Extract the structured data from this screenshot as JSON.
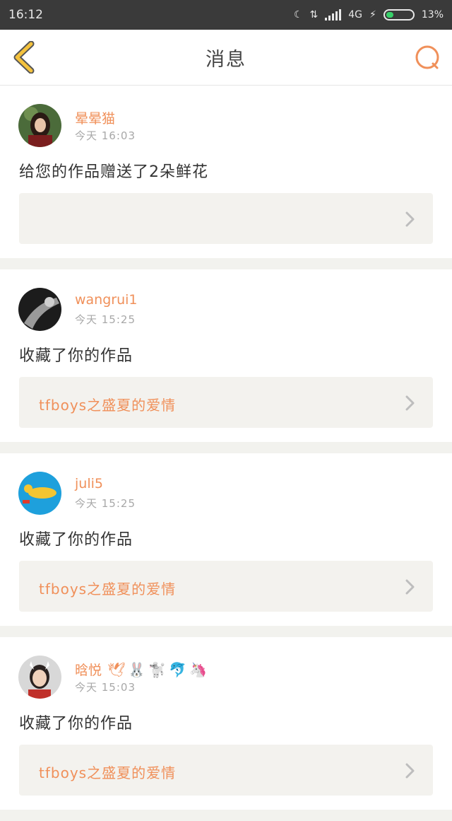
{
  "status_bar": {
    "time": "16:12",
    "network": "4G",
    "battery": "13%"
  },
  "header": {
    "title": "消息",
    "back_icon": "chevron-left-icon",
    "search_icon": "search-icon"
  },
  "colors": {
    "accent": "#f0905a",
    "back_arrow": "#f4c23d",
    "card_bg": "#ffffff",
    "work_bg": "#f3f2ee",
    "page_bg": "#f2f2ee"
  },
  "messages": [
    {
      "username": "晕晕猫",
      "emojis": "",
      "time": "今天 16:03",
      "text": "给您的作品赠送了2朵鲜花",
      "work_title": ""
    },
    {
      "username": "wangrui1",
      "emojis": "",
      "time": "今天 15:25",
      "text": "收藏了你的作品",
      "work_title": "tfboys之盛夏的爱情"
    },
    {
      "username": "juli5",
      "emojis": "",
      "time": "今天 15:25",
      "text": "收藏了你的作品",
      "work_title": "tfboys之盛夏的爱情"
    },
    {
      "username": "晗悦",
      "emojis": "🕊🐰🐩🐬🦄",
      "time": "今天 15:03",
      "text": "收藏了你的作品",
      "work_title": "tfboys之盛夏的爱情"
    }
  ]
}
